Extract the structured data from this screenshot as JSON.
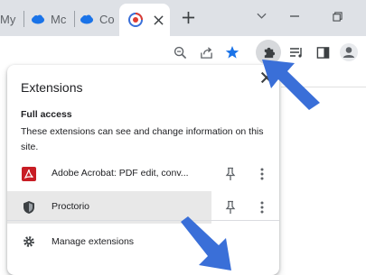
{
  "tabs": [
    {
      "label": "My",
      "active": false
    },
    {
      "label": "Mc",
      "active": false
    },
    {
      "label": "Co",
      "active": false
    },
    {
      "label": "",
      "active": true
    }
  ],
  "toolbar": {
    "icons": [
      "zoom-icon",
      "share-icon",
      "bookmark-star-icon",
      "extensions-puzzle-icon",
      "reading-list-icon",
      "side-panel-icon",
      "profile-icon"
    ]
  },
  "popup": {
    "title": "Extensions",
    "section_title": "Full access",
    "section_desc": "These extensions can see and change information on this site.",
    "extensions": [
      {
        "name": "Adobe Acrobat: PDF edit, conv...",
        "icon": "adobe-acrobat-icon"
      },
      {
        "name": "Proctorio",
        "icon": "proctorio-shield-icon"
      }
    ],
    "manage_label": "Manage extensions"
  },
  "colors": {
    "tabstrip": "#dee1e6",
    "accent_blue": "#1a73e8",
    "arrow_blue": "#3a6fd8",
    "adobe_red": "#c81d25",
    "hover_row": "#e8e8e8"
  }
}
